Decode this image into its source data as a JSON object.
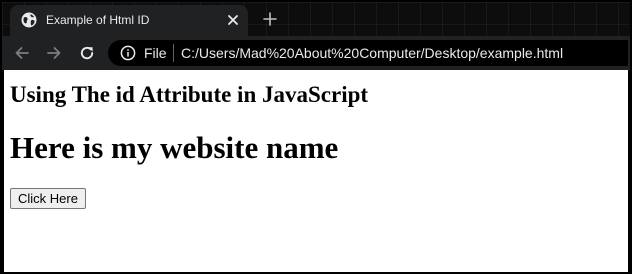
{
  "browser": {
    "tab": {
      "title": "Example of Html ID",
      "favicon_icon": "globe-icon",
      "close_icon": "close-icon"
    },
    "new_tab_icon": "plus-icon",
    "toolbar": {
      "back_icon": "arrow-left-icon",
      "forward_icon": "arrow-right-icon",
      "reload_icon": "reload-icon"
    },
    "address_bar": {
      "info_icon": "info-icon",
      "scheme_label": "File",
      "url": "C:/Users/Mad%20About%20Computer/Desktop/example.html"
    }
  },
  "page": {
    "subheading": "Using The id Attribute in JavaScript",
    "heading": "Here is my website name",
    "button_label": "Click Here"
  },
  "colors": {
    "tab_background": "#1f2122",
    "toolbar_background": "#1f2122",
    "omnibox_background": "#000000",
    "text_light": "#e8eaed",
    "page_background": "#ffffff"
  }
}
